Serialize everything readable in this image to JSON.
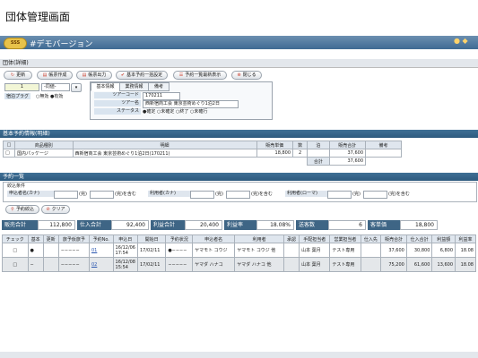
{
  "page": {
    "heading": "団体管理画面"
  },
  "app": {
    "logo_text": "SSS",
    "title": "#デモバージョン"
  },
  "subheader": {
    "label": "団体(詳細)"
  },
  "toolbar": {
    "buttons": [
      {
        "label": "更新"
      },
      {
        "label": "帳票作成"
      },
      {
        "label": "帳票出力"
      },
      {
        "label": "基本予約一括設定"
      },
      {
        "label": "予約一覧最新表示"
      },
      {
        "label": "閉じる"
      }
    ]
  },
  "left_form": {
    "number": "1",
    "select_value": "-同値-",
    "return_label": "宿泊プラグ",
    "radio1": "無効",
    "radio2": "有効"
  },
  "tabs": [
    "基本情報",
    "業務情報",
    "備考"
  ],
  "detail": {
    "code_label": "ツアーコード",
    "code_value": "170211",
    "name_label": "ツアー名",
    "name_value": "西新宿商工会 東京芸術めぐり1泊2日",
    "status_label": "ステータス",
    "status_options": [
      "確定",
      "未確定",
      "終了",
      "未確行"
    ]
  },
  "sections": {
    "basic": "基本予約情報(明細)",
    "list": "予約一覧",
    "conditions": "絞込条件"
  },
  "basic_table": {
    "headers": [
      "商品種別",
      "明細",
      "販売単価",
      "数",
      "泊",
      "販売合計",
      "備考"
    ],
    "row": [
      "国内パッケージ",
      "西新宿商工会 東京芸術めぐり1泊2日(170211)",
      "18,800",
      "2",
      "",
      "37,600",
      ""
    ],
    "total_label": "合計",
    "total_value": "37,600"
  },
  "conditions": {
    "fields": [
      {
        "label": "申込者名(カナ)",
        "suffix": "(完)",
        "suffix2": "(完)を含む"
      },
      {
        "label": "利用者(カナ)",
        "suffix": "(完)",
        "suffix2": "(完)を含む"
      },
      {
        "label": "利用者(ローマ)",
        "suffix": "(完)",
        "suffix2": "(完)を含む"
      }
    ],
    "buttons": [
      "予約絞込",
      "クリア"
    ]
  },
  "summary": [
    {
      "label": "販売合計",
      "value": "112,800"
    },
    {
      "label": "仕入合計",
      "value": "92,400"
    },
    {
      "label": "利益合計",
      "value": "20,400"
    },
    {
      "label": "利益率",
      "value": "18.08%"
    },
    {
      "label": "送客数",
      "value": "6"
    },
    {
      "label": "客単価",
      "value": "18,800"
    }
  ],
  "list": {
    "headers": [
      "チェック",
      "基本",
      "更新",
      "旅予仮旅予",
      "予約No.",
      "申込日",
      "開始日",
      "予約状況",
      "申込者名",
      "利用者",
      "承認",
      "手配担当者",
      "営業担当者",
      "仕入先",
      "販売合計",
      "仕入合計",
      "利益額",
      "利益率"
    ],
    "rows": [
      [
        "",
        "●",
        "",
        "−−−−−",
        "01",
        "16/12/06 17:54",
        "17/02/11",
        "●−−−−",
        "ヤマモト コウジ",
        "ヤマモト コウジ 他",
        "",
        "山本 葉月",
        "テスト専用",
        "",
        "37,600",
        "30,800",
        "6,800",
        "18.08"
      ],
      [
        "",
        "−",
        "",
        "−−−−−",
        "02",
        "16/12/08 15:54",
        "17/02/11",
        "−−−−−",
        "ヤマダ ハナコ",
        "ヤマダ ハナコ 他",
        "",
        "山本 葉月",
        "テスト専用",
        "",
        "75,200",
        "61,600",
        "13,600",
        "18.08"
      ]
    ]
  },
  "colors": {
    "accent": "#3e6585",
    "titlebar": "#4f7aa2"
  }
}
